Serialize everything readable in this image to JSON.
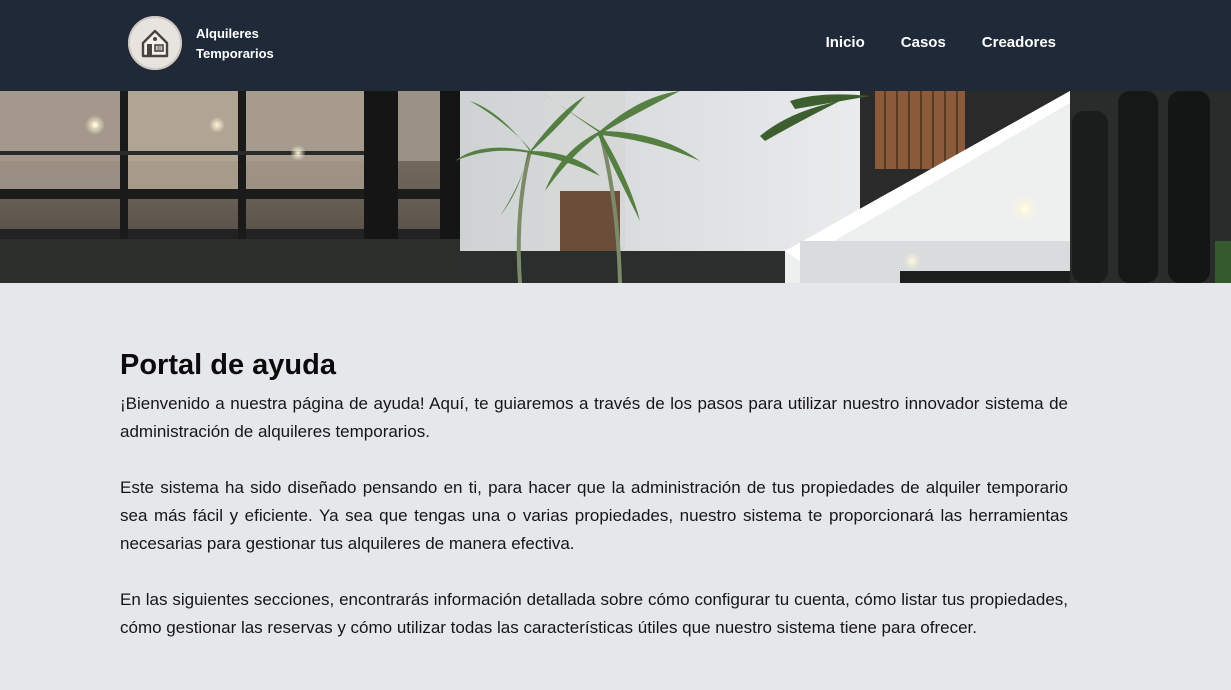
{
  "header": {
    "brand_line1": "Alquileres",
    "brand_line2": "Temporarios",
    "logo_icon": "house-icon",
    "nav": [
      {
        "label": "Inicio"
      },
      {
        "label": "Casos"
      },
      {
        "label": "Creadores"
      }
    ],
    "background_color": "#1f2937"
  },
  "hero": {
    "image_description_icon": "modern-house-photo"
  },
  "main": {
    "title": "Portal de ayuda",
    "paragraphs": [
      "¡Bienvenido a nuestra página de ayuda! Aquí, te guiaremos a través de los pasos para utilizar nuestro innovador sistema de administración de alquileres temporarios.",
      "Este sistema ha sido diseñado pensando en ti, para hacer que la administración de tus propiedades de alquiler temporario sea más fácil y eficiente. Ya sea que tengas una o varias propiedades, nuestro sistema te proporcionará las herramientas necesarias para gestionar tus alquileres de manera efectiva.",
      "En las siguientes secciones, encontrarás información detallada sobre cómo configurar tu cuenta, cómo listar tus propiedades, cómo gestionar las reservas y cómo utilizar todas las características útiles que nuestro sistema tiene para ofrecer."
    ],
    "background_color": "#e5e7eb"
  }
}
